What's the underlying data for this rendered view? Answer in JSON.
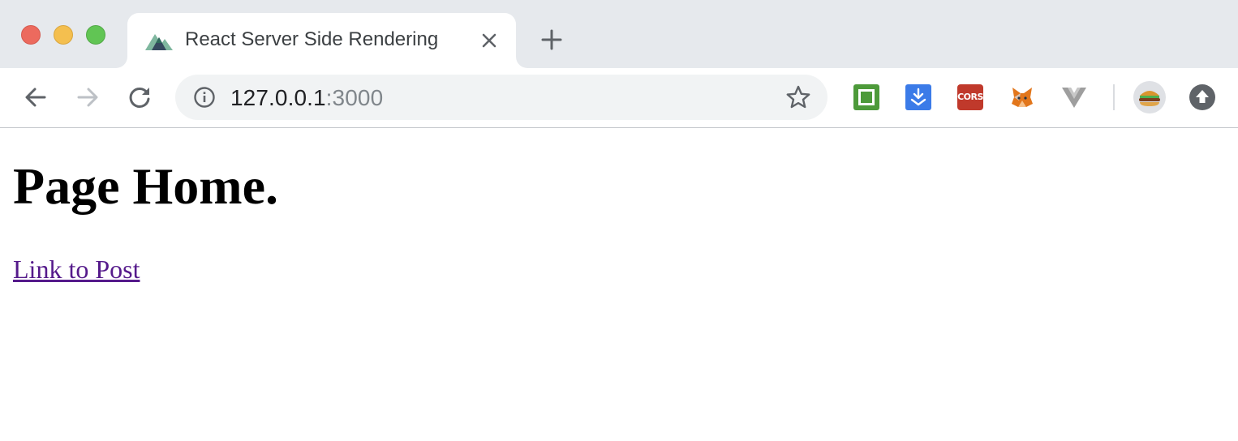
{
  "browser": {
    "tab": {
      "title": "React Server Side Rendering",
      "favicon": "mountain-favicon-icon"
    },
    "address_bar": {
      "host": "127.0.0.1",
      "port": ":3000"
    },
    "extensions": [
      "green-square-extension-icon",
      "blue-download-extension-icon",
      "cors-extension-icon",
      "metamask-fox-extension-icon",
      "vue-devtools-extension-icon"
    ],
    "extension_labels": {
      "cors": "CORS"
    }
  },
  "page": {
    "heading": "Page Home.",
    "link": "Link to Post"
  },
  "colors": {
    "tabstrip": "#e6e9ed",
    "omnibox": "#f1f3f4",
    "visited_link": "#551a8b"
  }
}
